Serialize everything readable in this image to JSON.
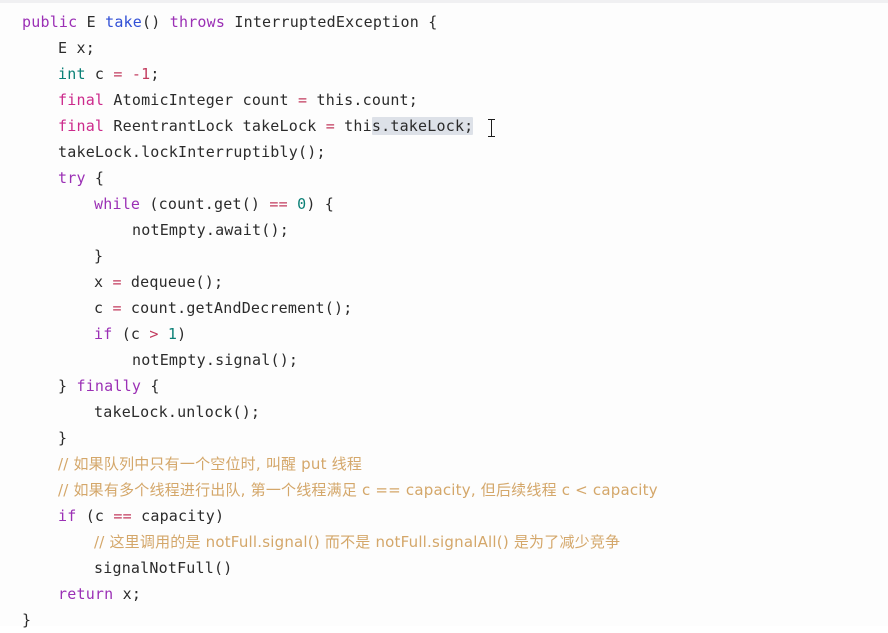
{
  "editor": {
    "background_color": "#fdfdfd",
    "foreground_color": "#2b2b2b",
    "selection_color": "#dde1e8",
    "comment_color": "#d4a76a",
    "keyword_color": "#9b30b5",
    "type_color": "#0b8076",
    "modifier_color": "#cc2a8c",
    "method_color": "#3250d6",
    "operator_color": "#c23b5e",
    "number_color": "#0b8076",
    "cursor_glyph": "I-beam"
  },
  "code": {
    "line01": {
      "t1": "public",
      "t2": " E ",
      "t3": "take",
      "t4": "() ",
      "t5": "throws",
      "t6": " InterruptedException {"
    },
    "line02": {
      "t1": "E x;"
    },
    "line03": {
      "t1": "int",
      "t2": " c ",
      "t3": "=",
      "t4": " ",
      "t5": "-1",
      "t6": ";"
    },
    "line04": {
      "t1": "final",
      "t2": " AtomicInteger count ",
      "t3": "=",
      "t4": " this.count;"
    },
    "line05": {
      "t1": "final",
      "t2": " ReentrantLock takeLock ",
      "t3": "=",
      "t4": " thi",
      "t5": "s.takeLock;"
    },
    "line06": {
      "t1": "takeLock.lockInterruptibly();"
    },
    "line07": {
      "t1": "try",
      "t2": " {"
    },
    "line08": {
      "t1": "while",
      "t2": " (count.get() ",
      "t3": "==",
      "t4": " ",
      "t5": "0",
      "t6": ") {"
    },
    "line09": {
      "t1": "notEmpty.await();"
    },
    "line10": {
      "t1": "}"
    },
    "line11": {
      "t1": "x ",
      "t2": "=",
      "t3": " dequeue();"
    },
    "line12": {
      "t1": "c ",
      "t2": "=",
      "t3": " count.getAndDecrement();"
    },
    "line13": {
      "t1": "if",
      "t2": " (c ",
      "t3": ">",
      "t4": " ",
      "t5": "1",
      "t6": ")"
    },
    "line14": {
      "t1": "notEmpty.signal();"
    },
    "line15": {
      "t1": "} ",
      "t2": "finally",
      "t3": " {"
    },
    "line16": {
      "t1": "takeLock.unlock();"
    },
    "line17": {
      "t1": "}"
    },
    "line18": {
      "t1": "// 如果队列中只有一个空位时, 叫醒 put 线程"
    },
    "line19": {
      "t1": "// 如果有多个线程进行出队, 第一个线程满足 c == capacity, 但后续线程 c < capacity"
    },
    "line20": {
      "t1": "if",
      "t2": " (c ",
      "t3": "==",
      "t4": " capacity)"
    },
    "line21": {
      "t1": "// 这里调用的是 notFull.signal() 而不是 notFull.signalAll() 是为了减少竞争"
    },
    "line22": {
      "t1": "signalNotFull()"
    },
    "line23": {
      "t1": "return",
      "t2": " x;"
    },
    "line24": {
      "t1": "}"
    }
  }
}
